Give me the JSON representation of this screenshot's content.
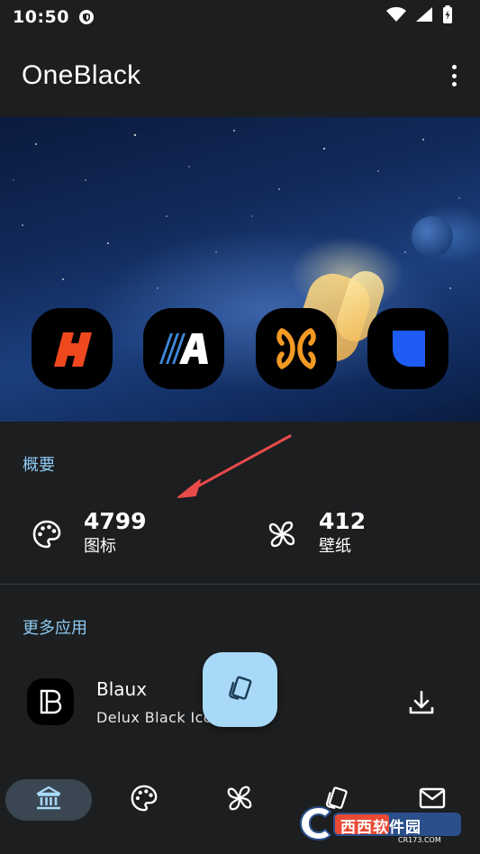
{
  "status_bar": {
    "time": "10:50"
  },
  "app_bar": {
    "title": "OneBlack",
    "menu_icon": "more-vert-icon"
  },
  "hero": {
    "icons": [
      "app-icon-orange-h",
      "app-icon-white-a",
      "app-icon-orange-x",
      "app-icon-blue-d"
    ]
  },
  "overview": {
    "title": "概要",
    "stats": [
      {
        "value": "4799",
        "label": "图标",
        "icon": "palette-icon"
      },
      {
        "value": "412",
        "label": "壁纸",
        "icon": "pinwheel-icon"
      }
    ]
  },
  "more_apps": {
    "title": "更多应用",
    "apps": [
      {
        "name": "Blaux",
        "description": "Delux Black Icon"
      }
    ]
  },
  "fab": {
    "icon": "cards-icon"
  },
  "bottom_nav": {
    "items": [
      {
        "icon": "home-icon",
        "active": true
      },
      {
        "icon": "palette-icon",
        "active": false
      },
      {
        "icon": "pinwheel-icon",
        "active": false
      },
      {
        "icon": "cards-icon",
        "active": false
      },
      {
        "icon": "mail-icon",
        "active": false
      }
    ]
  },
  "colors": {
    "accent": "#8ec9f2",
    "fab": "#a8d9f8",
    "background": "#1c1e20",
    "active_nav": "#3a4652"
  },
  "watermark": {
    "text": "西西软件园",
    "subtext": "CR173.COM"
  }
}
